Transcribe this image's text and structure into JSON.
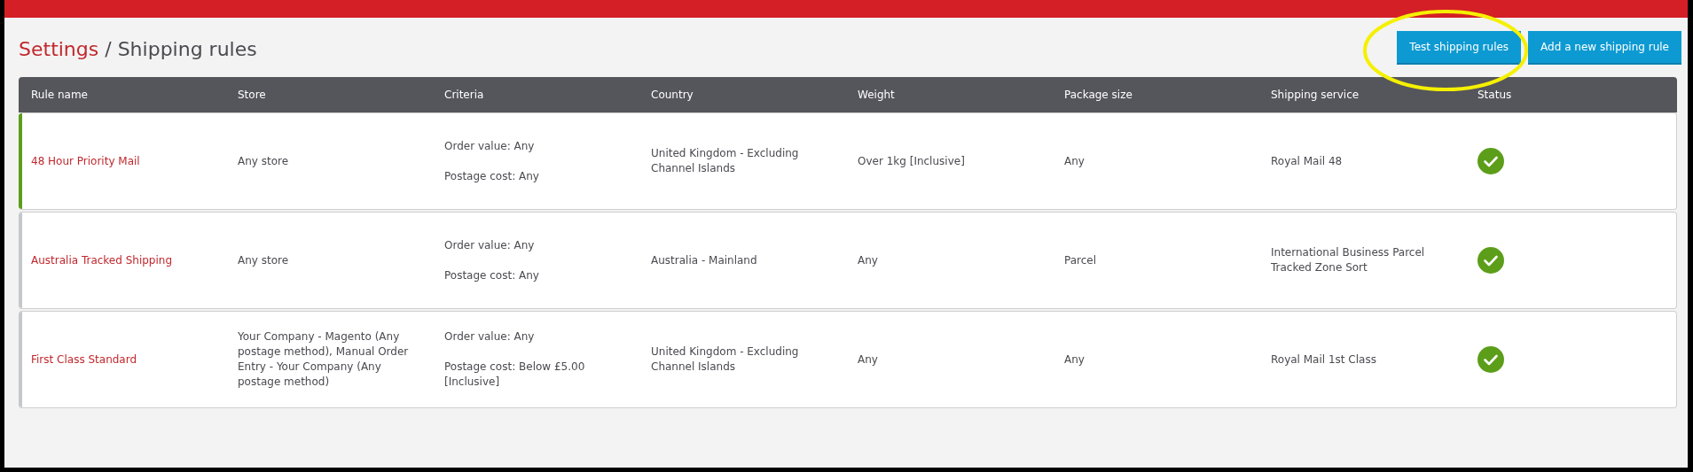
{
  "breadcrumb": {
    "parent": "Settings",
    "separator": "/",
    "current": "Shipping rules"
  },
  "buttons": [
    {
      "label": "Test shipping rules",
      "circled": true
    },
    {
      "label": "Add a new shipping rule",
      "circled": false
    }
  ],
  "table": {
    "columns": [
      "Rule name",
      "Store",
      "Criteria",
      "Country",
      "Weight",
      "Package size",
      "Shipping service",
      "Status"
    ],
    "rows": [
      {
        "name": "48 Hour Priority Mail",
        "highlighted": true,
        "store": "Any store",
        "criteria": [
          "Order value: Any",
          "Postage cost: Any"
        ],
        "country": "United Kingdom - Excluding Channel Islands",
        "weight": "Over 1kg [Inclusive]",
        "package_size": "Any",
        "service": "Royal Mail 48",
        "enabled": true
      },
      {
        "name": "Australia Tracked Shipping",
        "highlighted": false,
        "store": "Any store",
        "criteria": [
          "Order value: Any",
          "Postage cost: Any"
        ],
        "country": "Australia - Mainland",
        "weight": "Any",
        "package_size": "Parcel",
        "service": "International Business Parcel Tracked Zone Sort",
        "enabled": true
      },
      {
        "name": "First Class Standard",
        "highlighted": false,
        "store": "Your Company - Magento (Any postage method), Manual Order Entry - Your Company (Any postage method)",
        "criteria": [
          "Order value: Any",
          "Postage cost: Below £5.00 [Inclusive]"
        ],
        "country": "United Kingdom - Excluding Channel Islands",
        "weight": "Any",
        "package_size": "Any",
        "service": "Royal Mail 1st Class",
        "enabled": true
      }
    ]
  }
}
